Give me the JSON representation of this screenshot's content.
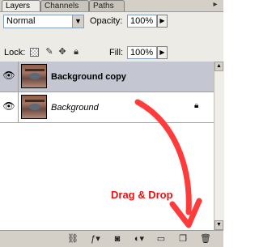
{
  "tabs": [
    {
      "label": "Layers"
    },
    {
      "label": "Channels"
    },
    {
      "label": "Paths"
    }
  ],
  "blend_mode": "Normal",
  "opacity": {
    "label": "Opacity:",
    "value": "100%"
  },
  "lock": {
    "label": "Lock:"
  },
  "fill": {
    "label": "Fill:",
    "value": "100%"
  },
  "layers": [
    {
      "name": "Background copy",
      "selected": true
    },
    {
      "name": "Background",
      "selected": false,
      "locked": true
    }
  ],
  "annotation": "Drag & Drop",
  "colors": {
    "annotation": "#ee1111",
    "selected_row": "#c4c6d2"
  }
}
